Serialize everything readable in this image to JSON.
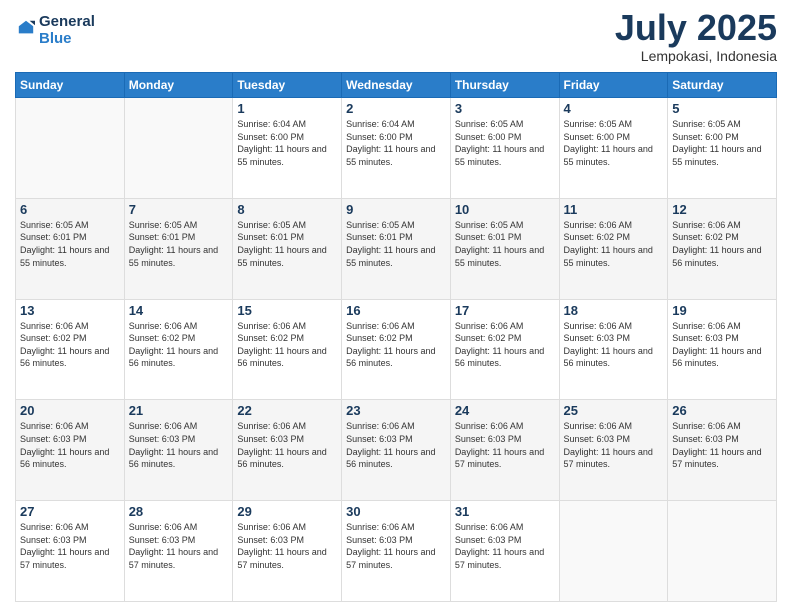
{
  "header": {
    "logo_line1": "General",
    "logo_line2": "Blue",
    "month_year": "July 2025",
    "location": "Lempokasi, Indonesia"
  },
  "days_of_week": [
    "Sunday",
    "Monday",
    "Tuesday",
    "Wednesday",
    "Thursday",
    "Friday",
    "Saturday"
  ],
  "weeks": [
    [
      {
        "day": "",
        "info": ""
      },
      {
        "day": "",
        "info": ""
      },
      {
        "day": "1",
        "info": "Sunrise: 6:04 AM\nSunset: 6:00 PM\nDaylight: 11 hours and 55 minutes."
      },
      {
        "day": "2",
        "info": "Sunrise: 6:04 AM\nSunset: 6:00 PM\nDaylight: 11 hours and 55 minutes."
      },
      {
        "day": "3",
        "info": "Sunrise: 6:05 AM\nSunset: 6:00 PM\nDaylight: 11 hours and 55 minutes."
      },
      {
        "day": "4",
        "info": "Sunrise: 6:05 AM\nSunset: 6:00 PM\nDaylight: 11 hours and 55 minutes."
      },
      {
        "day": "5",
        "info": "Sunrise: 6:05 AM\nSunset: 6:00 PM\nDaylight: 11 hours and 55 minutes."
      }
    ],
    [
      {
        "day": "6",
        "info": "Sunrise: 6:05 AM\nSunset: 6:01 PM\nDaylight: 11 hours and 55 minutes."
      },
      {
        "day": "7",
        "info": "Sunrise: 6:05 AM\nSunset: 6:01 PM\nDaylight: 11 hours and 55 minutes."
      },
      {
        "day": "8",
        "info": "Sunrise: 6:05 AM\nSunset: 6:01 PM\nDaylight: 11 hours and 55 minutes."
      },
      {
        "day": "9",
        "info": "Sunrise: 6:05 AM\nSunset: 6:01 PM\nDaylight: 11 hours and 55 minutes."
      },
      {
        "day": "10",
        "info": "Sunrise: 6:05 AM\nSunset: 6:01 PM\nDaylight: 11 hours and 55 minutes."
      },
      {
        "day": "11",
        "info": "Sunrise: 6:06 AM\nSunset: 6:02 PM\nDaylight: 11 hours and 55 minutes."
      },
      {
        "day": "12",
        "info": "Sunrise: 6:06 AM\nSunset: 6:02 PM\nDaylight: 11 hours and 56 minutes."
      }
    ],
    [
      {
        "day": "13",
        "info": "Sunrise: 6:06 AM\nSunset: 6:02 PM\nDaylight: 11 hours and 56 minutes."
      },
      {
        "day": "14",
        "info": "Sunrise: 6:06 AM\nSunset: 6:02 PM\nDaylight: 11 hours and 56 minutes."
      },
      {
        "day": "15",
        "info": "Sunrise: 6:06 AM\nSunset: 6:02 PM\nDaylight: 11 hours and 56 minutes."
      },
      {
        "day": "16",
        "info": "Sunrise: 6:06 AM\nSunset: 6:02 PM\nDaylight: 11 hours and 56 minutes."
      },
      {
        "day": "17",
        "info": "Sunrise: 6:06 AM\nSunset: 6:02 PM\nDaylight: 11 hours and 56 minutes."
      },
      {
        "day": "18",
        "info": "Sunrise: 6:06 AM\nSunset: 6:03 PM\nDaylight: 11 hours and 56 minutes."
      },
      {
        "day": "19",
        "info": "Sunrise: 6:06 AM\nSunset: 6:03 PM\nDaylight: 11 hours and 56 minutes."
      }
    ],
    [
      {
        "day": "20",
        "info": "Sunrise: 6:06 AM\nSunset: 6:03 PM\nDaylight: 11 hours and 56 minutes."
      },
      {
        "day": "21",
        "info": "Sunrise: 6:06 AM\nSunset: 6:03 PM\nDaylight: 11 hours and 56 minutes."
      },
      {
        "day": "22",
        "info": "Sunrise: 6:06 AM\nSunset: 6:03 PM\nDaylight: 11 hours and 56 minutes."
      },
      {
        "day": "23",
        "info": "Sunrise: 6:06 AM\nSunset: 6:03 PM\nDaylight: 11 hours and 56 minutes."
      },
      {
        "day": "24",
        "info": "Sunrise: 6:06 AM\nSunset: 6:03 PM\nDaylight: 11 hours and 57 minutes."
      },
      {
        "day": "25",
        "info": "Sunrise: 6:06 AM\nSunset: 6:03 PM\nDaylight: 11 hours and 57 minutes."
      },
      {
        "day": "26",
        "info": "Sunrise: 6:06 AM\nSunset: 6:03 PM\nDaylight: 11 hours and 57 minutes."
      }
    ],
    [
      {
        "day": "27",
        "info": "Sunrise: 6:06 AM\nSunset: 6:03 PM\nDaylight: 11 hours and 57 minutes."
      },
      {
        "day": "28",
        "info": "Sunrise: 6:06 AM\nSunset: 6:03 PM\nDaylight: 11 hours and 57 minutes."
      },
      {
        "day": "29",
        "info": "Sunrise: 6:06 AM\nSunset: 6:03 PM\nDaylight: 11 hours and 57 minutes."
      },
      {
        "day": "30",
        "info": "Sunrise: 6:06 AM\nSunset: 6:03 PM\nDaylight: 11 hours and 57 minutes."
      },
      {
        "day": "31",
        "info": "Sunrise: 6:06 AM\nSunset: 6:03 PM\nDaylight: 11 hours and 57 minutes."
      },
      {
        "day": "",
        "info": ""
      },
      {
        "day": "",
        "info": ""
      }
    ]
  ]
}
